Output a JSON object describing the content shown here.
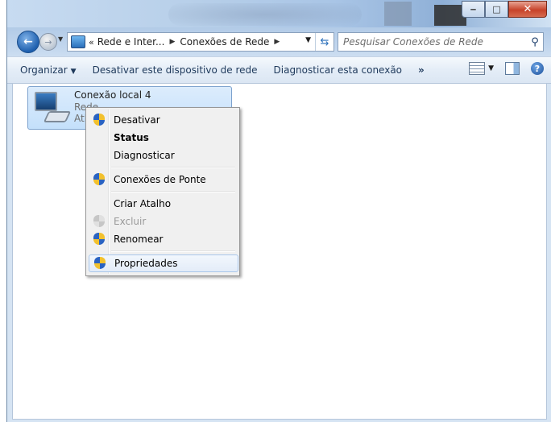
{
  "window": {
    "controls": {
      "minimize": "‒",
      "maximize": "□",
      "close": "✕"
    }
  },
  "address": {
    "chevrons": "«",
    "crumbs": [
      "Rede e Inter...",
      "Conexões de Rede"
    ],
    "search_placeholder": "Pesquisar Conexões de Rede"
  },
  "toolbar": {
    "organize": "Organizar",
    "disable_device": "Desativar este dispositivo de rede",
    "diagnose": "Diagnosticar esta conexão",
    "more": "»"
  },
  "connection": {
    "name": "Conexão local 4",
    "network": "Rede",
    "device": "Atl"
  },
  "context_menu": {
    "items": [
      {
        "label": "Desativar",
        "icon": "uac-shield-icon"
      },
      {
        "label": "Status",
        "bold": true
      },
      {
        "label": "Diagnosticar"
      },
      {
        "label": "Conexões de Ponte",
        "icon": "uac-shield-icon"
      },
      {
        "label": "Criar Atalho"
      },
      {
        "label": "Excluir",
        "icon": "uac-shield-icon",
        "disabled": true
      },
      {
        "label": "Renomear",
        "icon": "uac-shield-icon"
      },
      {
        "label": "Propriedades",
        "icon": "uac-shield-icon",
        "highlighted": true
      }
    ]
  }
}
